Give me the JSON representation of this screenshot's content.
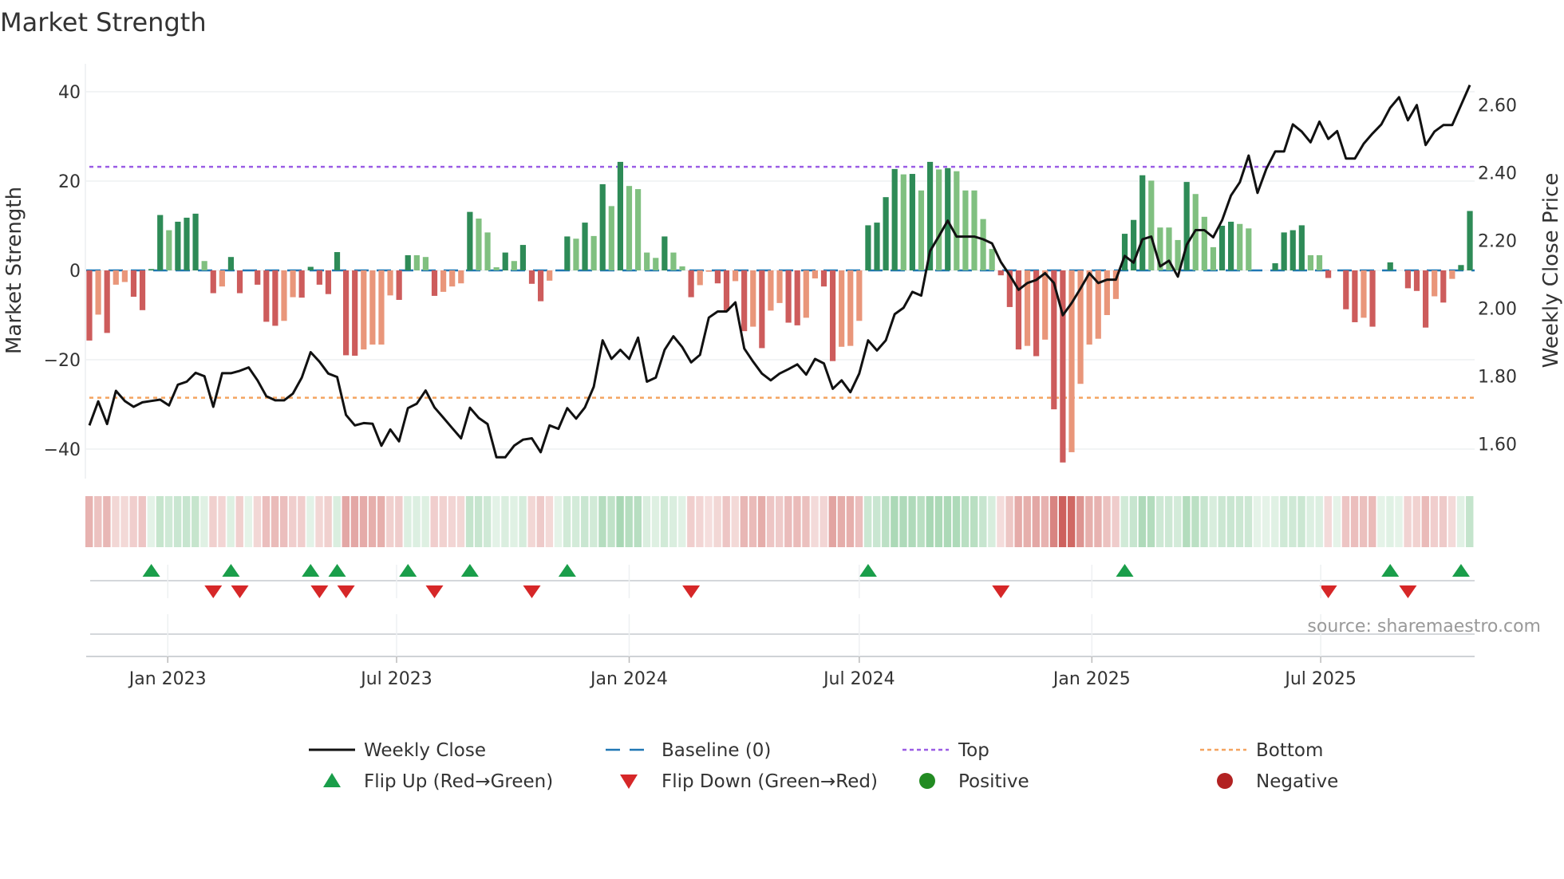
{
  "chart_data": {
    "type": "bar",
    "title": "Market Strength",
    "ylabel": "Market Strength",
    "ylabel_right": "Weekly Close Price",
    "ylim": [
      -45,
      45
    ],
    "ylim_right": [
      1.5,
      2.66
    ],
    "yticks": [
      40,
      20,
      0,
      -20,
      -40
    ],
    "yticks_labels": [
      "40",
      "20",
      "0",
      "−20",
      "−40"
    ],
    "yticks_right": [
      2.6,
      2.4,
      2.2,
      2.0,
      1.8,
      1.6
    ],
    "yticks_right_labels": [
      "2.60",
      "2.40",
      "2.20",
      "2.00",
      "1.80",
      "1.60"
    ],
    "start_week": "2022-10-31",
    "xticks": [
      {
        "date": "2023-01-01",
        "label": "Jan 2023"
      },
      {
        "date": "2023-07-01",
        "label": "Jul 2023"
      },
      {
        "date": "2024-01-01",
        "label": "Jan 2024"
      },
      {
        "date": "2024-07-01",
        "label": "Jul 2024"
      },
      {
        "date": "2025-01-01",
        "label": "Jan 2025"
      },
      {
        "date": "2025-07-01",
        "label": "Jul 2025"
      }
    ],
    "top_level": 23.2,
    "bottom_level": -28.5,
    "baseline": 0,
    "grid": true,
    "legend_position": "bottom",
    "strength": [
      -15.7,
      -9.9,
      -14,
      -3.2,
      -2.6,
      -5.9,
      -8.9,
      0.3,
      12.4,
      9,
      10.9,
      11.8,
      12.7,
      2.1,
      -5.1,
      -3.6,
      3,
      -5.1,
      0,
      -3.2,
      -11.5,
      -12.4,
      -11.3,
      -6,
      -6.1,
      0.8,
      -3.2,
      -5.3,
      4.1,
      -19,
      -19.1,
      -17.7,
      -16.6,
      -16.6,
      -5.6,
      -6.6,
      3.4,
      3.4,
      3,
      -5.7,
      -4.8,
      -3.6,
      -2.9,
      13.1,
      11.6,
      8.5,
      0.7,
      4,
      2.1,
      5.7,
      -3,
      -6.9,
      -2.3,
      0,
      7.6,
      7.1,
      10.7,
      7.7,
      19.3,
      14.4,
      24.3,
      18.9,
      18.2,
      4,
      2.8,
      7.6,
      4,
      0.9,
      -6,
      -3.3,
      -0.3,
      -2.9,
      -9.1,
      -2.4,
      -13.6,
      -12.6,
      -17.4,
      -9,
      -7.3,
      -11.7,
      -12.3,
      -10.6,
      -1.8,
      -3.6,
      -20.3,
      -17.1,
      -16.9,
      -11.3,
      10.1,
      10.7,
      16.4,
      22.7,
      21.5,
      21.6,
      17.9,
      24.3,
      22.6,
      22.9,
      22.2,
      17.9,
      17.9,
      11.5,
      4.8,
      -1.1,
      -8.2,
      -17.7,
      -16.9,
      -19.2,
      -15.5,
      -31.1,
      -43,
      -40.7,
      -25.4,
      -16.6,
      -15.3,
      -10,
      -6.4,
      8.2,
      11.3,
      21.3,
      20.1,
      9.6,
      9.6,
      6.8,
      19.8,
      17.1,
      12,
      5.2,
      10,
      10.9,
      10.4,
      9.4,
      0,
      0,
      1.6,
      8.5,
      9,
      10.1,
      3.4,
      3.4,
      -1.7,
      0,
      -8.7,
      -11.6,
      -10.6,
      -12.6,
      0,
      1.8,
      0,
      -4,
      -4.6,
      -12.8,
      -5.8,
      -7.2,
      -1.9,
      1.2,
      13.3
    ],
    "weekly_close": [
      1.655,
      1.726,
      1.659,
      1.757,
      1.727,
      1.71,
      1.723,
      1.727,
      1.731,
      1.714,
      1.775,
      1.784,
      1.81,
      1.8,
      1.71,
      1.809,
      1.809,
      1.816,
      1.826,
      1.788,
      1.741,
      1.729,
      1.729,
      1.749,
      1.796,
      1.871,
      1.843,
      1.808,
      1.798,
      1.686,
      1.655,
      1.662,
      1.66,
      1.595,
      1.643,
      1.608,
      1.706,
      1.719,
      1.758,
      1.708,
      1.678,
      1.647,
      1.617,
      1.707,
      1.677,
      1.659,
      1.561,
      1.561,
      1.595,
      1.613,
      1.617,
      1.576,
      1.655,
      1.645,
      1.706,
      1.675,
      1.708,
      1.769,
      1.906,
      1.851,
      1.878,
      1.851,
      1.914,
      1.784,
      1.796,
      1.878,
      1.918,
      1.886,
      1.841,
      1.863,
      1.973,
      1.991,
      1.991,
      2.018,
      1.882,
      1.843,
      1.808,
      1.788,
      1.808,
      1.821,
      1.835,
      1.805,
      1.851,
      1.838,
      1.763,
      1.788,
      1.753,
      1.808,
      1.906,
      1.876,
      1.906,
      1.983,
      2.002,
      2.049,
      2.038,
      2.169,
      2.213,
      2.259,
      2.212,
      2.212,
      2.212,
      2.204,
      2.192,
      2.137,
      2.098,
      2.055,
      2.075,
      2.084,
      2.104,
      2.075,
      1.98,
      2.016,
      2.059,
      2.104,
      2.075,
      2.085,
      2.085,
      2.155,
      2.135,
      2.204,
      2.212,
      2.124,
      2.141,
      2.094,
      2.188,
      2.231,
      2.231,
      2.21,
      2.26,
      2.333,
      2.372,
      2.451,
      2.341,
      2.412,
      2.463,
      2.463,
      2.543,
      2.522,
      2.49,
      2.551,
      2.5,
      2.523,
      2.442,
      2.442,
      2.486,
      2.516,
      2.543,
      2.592,
      2.623,
      2.555,
      2.6,
      2.482,
      2.522,
      2.541,
      2.541,
      2.6,
      2.659
    ],
    "legend": [
      {
        "label": "Weekly Close",
        "kind": "line"
      },
      {
        "label": "Baseline (0)",
        "kind": "dash"
      },
      {
        "label": "Top",
        "kind": "dot-top"
      },
      {
        "label": "Bottom",
        "kind": "dot-bottom"
      },
      {
        "label": "Flip Up (Red→Green)",
        "kind": "tri-up"
      },
      {
        "label": "Flip Down (Green→Red)",
        "kind": "tri-down"
      },
      {
        "label": "Positive",
        "kind": "dot-pos"
      },
      {
        "label": "Negative",
        "kind": "dot-neg"
      }
    ],
    "source": "source: sharemaestro.com"
  },
  "colors": {
    "pos_strong": "#2e8b57",
    "pos_weak": "#80c080",
    "neg_strong": "#cd5c5c",
    "neg_weak": "#e9967a",
    "baseline": "#1f77b4",
    "top": "#9b5de5",
    "bottom": "#f4a460",
    "flip_up": "#1a9e4a",
    "flip_down": "#d62728",
    "positive": "#228b22",
    "negative": "#b22222",
    "price": "#111111"
  }
}
